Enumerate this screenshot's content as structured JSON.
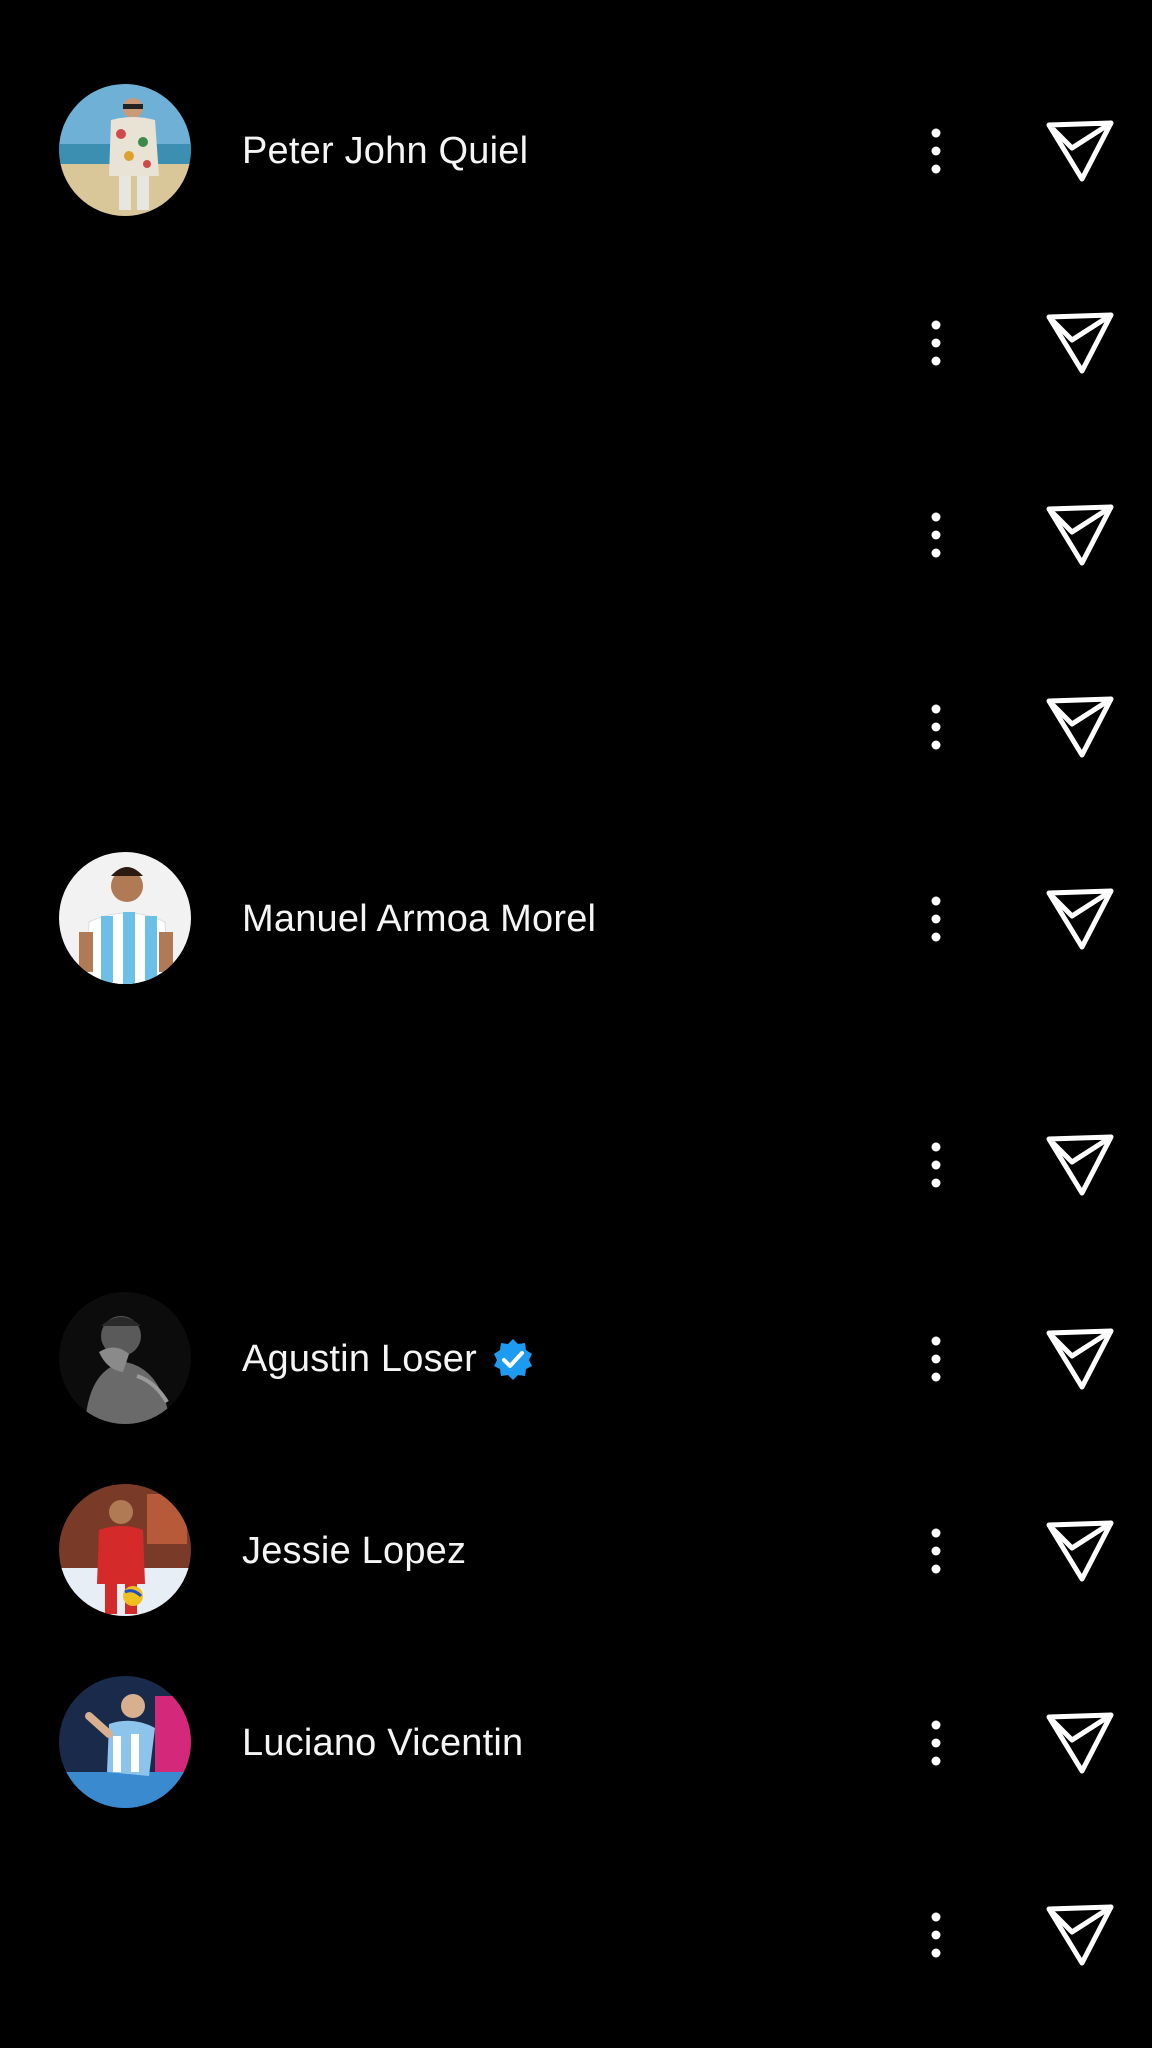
{
  "colors": {
    "background": "#000000",
    "text": "#f5f5f5",
    "verified": "#1d9bf0"
  },
  "rows": [
    {
      "name": "Peter John Quiel",
      "verified": false,
      "has_avatar": true
    },
    {
      "name": "",
      "verified": false,
      "has_avatar": false
    },
    {
      "name": "",
      "verified": false,
      "has_avatar": false
    },
    {
      "name": "",
      "verified": false,
      "has_avatar": false
    },
    {
      "name": "Manuel Armoa Morel",
      "verified": false,
      "has_avatar": true
    },
    {
      "name": "",
      "verified": false,
      "has_avatar": false
    },
    {
      "name": "Agustin Loser",
      "verified": true,
      "has_avatar": true
    },
    {
      "name": "Jessie Lopez",
      "verified": false,
      "has_avatar": true
    },
    {
      "name": "Luciano Vicentin",
      "verified": false,
      "has_avatar": true
    },
    {
      "name": "",
      "verified": false,
      "has_avatar": false
    }
  ],
  "icons": {
    "more": "more-vertical-icon",
    "send": "paper-plane-send-icon",
    "verified": "verified-badge-icon"
  }
}
